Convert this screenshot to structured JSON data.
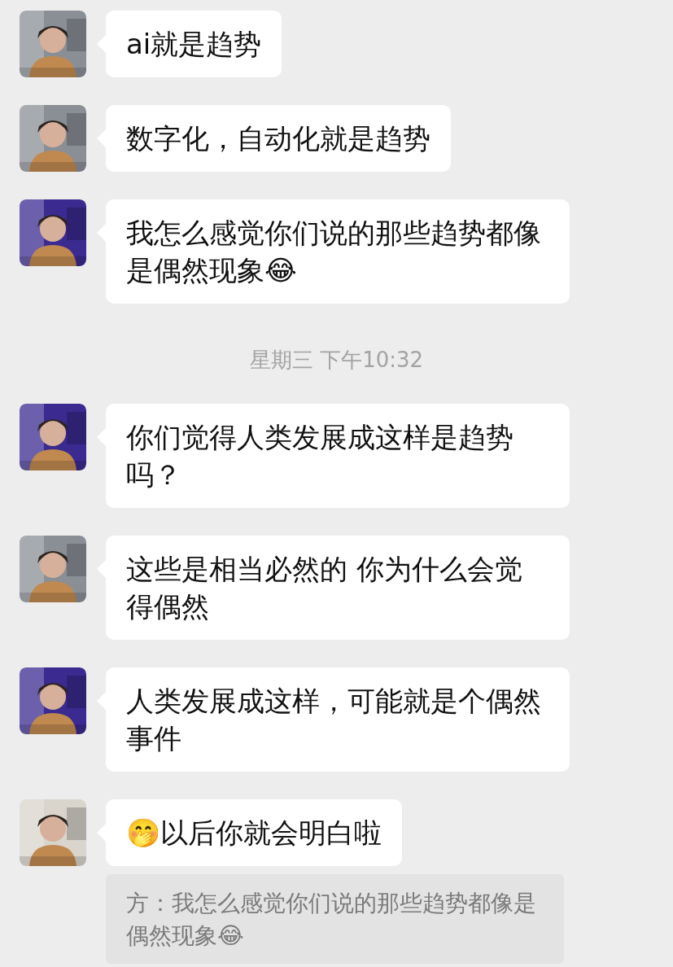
{
  "messages": [
    {
      "kind": "message",
      "text": "ai就是趋势"
    },
    {
      "kind": "message",
      "text": "数字化，自动化就是趋势"
    },
    {
      "kind": "message",
      "text": "我怎么感觉你们说的那些趋势都像是偶然现象😂"
    },
    {
      "kind": "time",
      "text": "星期三 下午10:32"
    },
    {
      "kind": "message",
      "text": "你们觉得人类发展成这样是趋势吗？"
    },
    {
      "kind": "message",
      "text": "这些是相当必然的 你为什么会觉得偶然"
    },
    {
      "kind": "message",
      "text": "人类发展成这样，可能就是个偶然事件"
    },
    {
      "kind": "message",
      "text": "🤭以后你就会明白啦",
      "quote": "方：我怎么感觉你们说的那些趋势都像是偶然现象😂"
    }
  ]
}
